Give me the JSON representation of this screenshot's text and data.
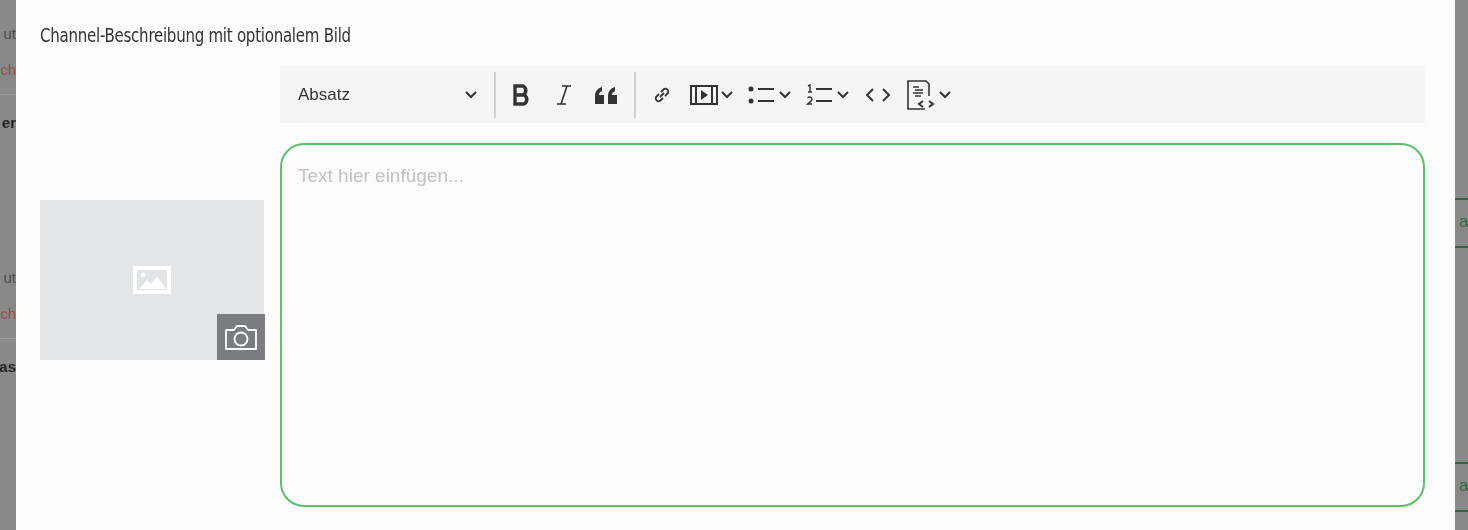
{
  "backdrop": {
    "left": [
      {
        "text": "ut",
        "kind": "muted",
        "divider_after": false
      },
      {
        "text": "ch",
        "kind": "link",
        "divider_after": true
      },
      {
        "text": "er",
        "kind": "heading",
        "divider_after": false
      },
      {
        "text": "ut",
        "kind": "muted",
        "divider_after": false
      },
      {
        "text": "ch",
        "kind": "link",
        "divider_after": true
      },
      {
        "text": "as",
        "kind": "heading",
        "divider_after": false
      }
    ],
    "right": [
      {
        "text": "a"
      },
      {
        "text": "a"
      }
    ]
  },
  "modal": {
    "title": "Channel-Beschreibung mit optionalem Bild",
    "toolbar": {
      "block_format": "Absatz",
      "groups": [
        [
          {
            "kind": "bold",
            "dropdown": false
          },
          {
            "kind": "italic",
            "dropdown": false
          },
          {
            "kind": "quote",
            "dropdown": false
          }
        ],
        [
          {
            "kind": "link",
            "dropdown": false
          },
          {
            "kind": "media",
            "dropdown": true
          },
          {
            "kind": "bulleted-list",
            "dropdown": true
          },
          {
            "kind": "numbered-list",
            "dropdown": true
          },
          {
            "kind": "code",
            "dropdown": false
          },
          {
            "kind": "source",
            "dropdown": true
          }
        ]
      ]
    },
    "editor": {
      "placeholder": "Text hier einfügen..."
    }
  }
}
